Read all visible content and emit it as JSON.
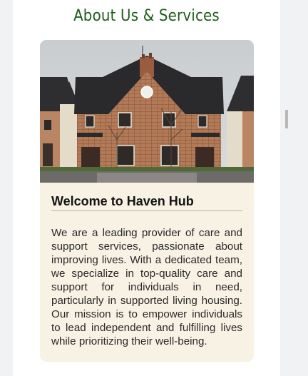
{
  "section": {
    "title": "About Us & Services"
  },
  "card": {
    "image_alt": "Brick house",
    "heading": "Welcome to Haven Hub",
    "body": "We are a leading provider of care and support services, passionate about improving lives. With a dedicated team, we specialize in top-quality care and support for individuals in need, particularly in supported living housing. Our mission is to empower individuals to lead independent and fulfilling lives while prioritizing their well-being."
  },
  "colors": {
    "title": "#1d5e1a",
    "card_bg": "#f8f2e5",
    "page_bg": "#ffffff",
    "outer_bg": "#f1f2f4"
  }
}
